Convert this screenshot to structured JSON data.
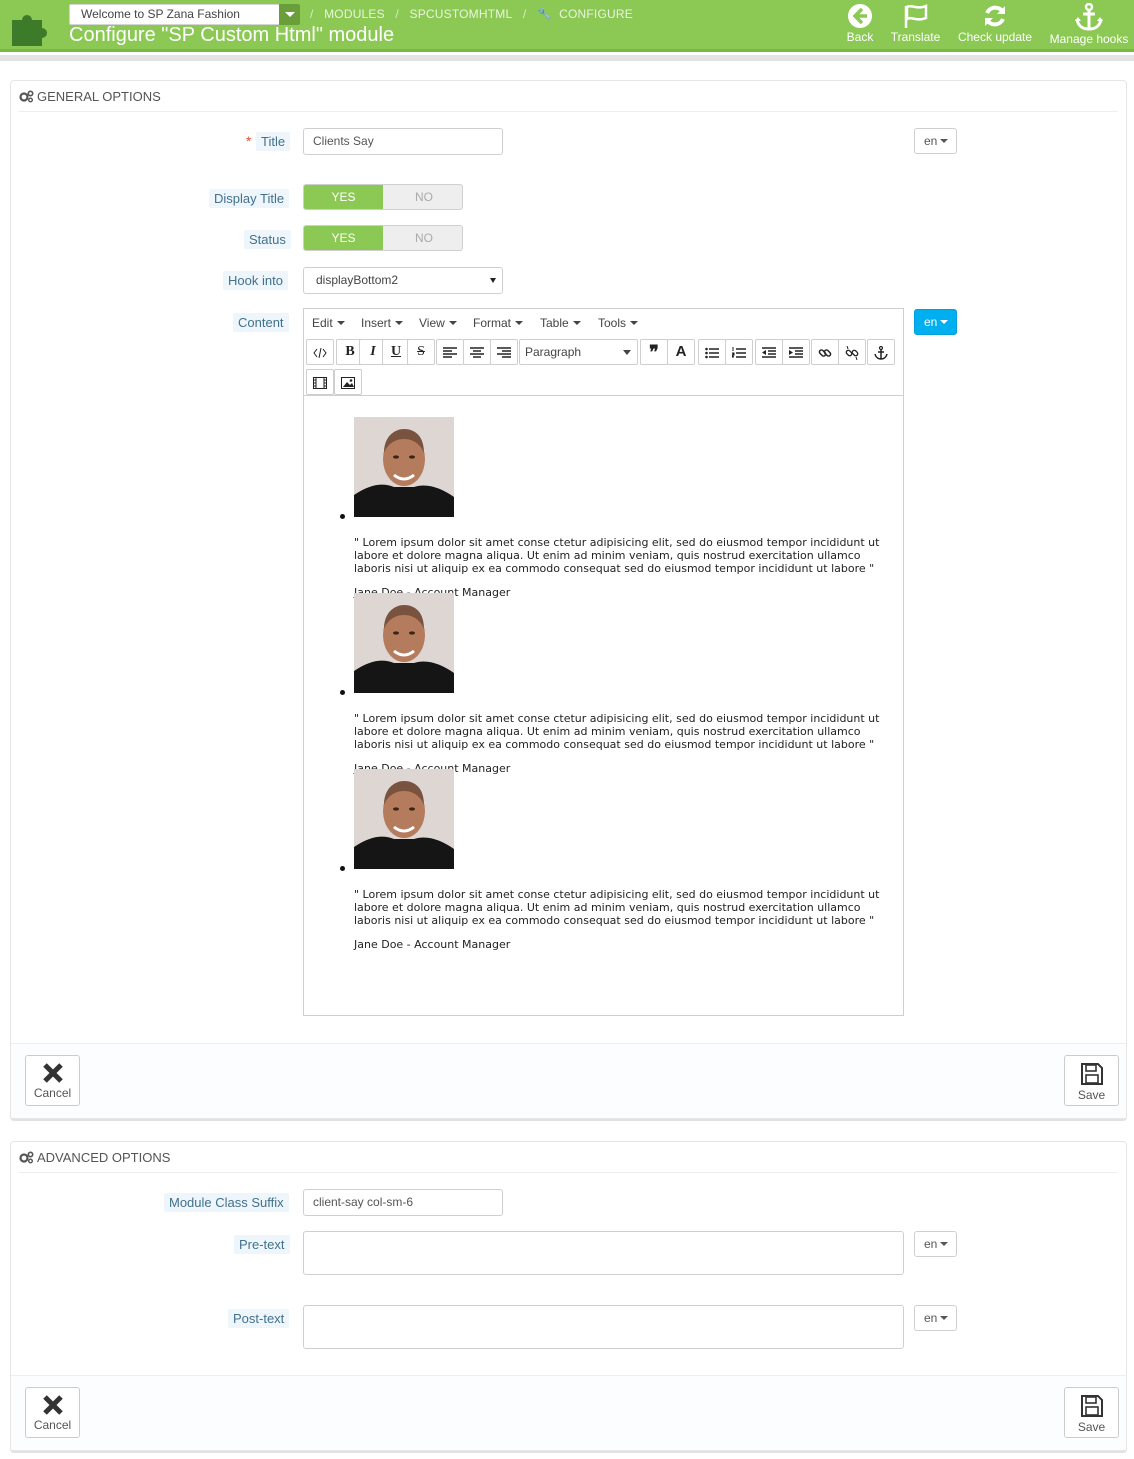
{
  "header": {
    "shop_selector": "Welcome to SP Zana Fashion",
    "breadcrumb": [
      "MODULES",
      "SPCUSTOMHTML",
      "CONFIGURE"
    ],
    "title": "Configure \"SP Custom Html\" module",
    "toolbar": [
      {
        "label": "Back",
        "icon": "back-arrow-icon"
      },
      {
        "label": "Translate",
        "icon": "flag-icon"
      },
      {
        "label": "Check update",
        "icon": "refresh-icon"
      },
      {
        "label": "Manage hooks",
        "icon": "anchor-icon"
      }
    ],
    "accent": "#8bc954"
  },
  "general": {
    "heading": "GENERAL OPTIONS",
    "title_label": "Title",
    "title_value": "Clients Say",
    "lang": "en",
    "display_title_label": "Display Title",
    "status_label": "Status",
    "yes": "YES",
    "no": "NO",
    "hook_label": "Hook into",
    "hook_value": "displayBottom2",
    "content_label": "Content",
    "editor": {
      "menus": [
        "Edit",
        "Insert",
        "View",
        "Format",
        "Table",
        "Tools"
      ],
      "format_select": "Paragraph",
      "toolbar_icons": [
        "code-icon",
        "bold-icon",
        "italic-icon",
        "underline-icon",
        "strikethrough-icon",
        "align-left-icon",
        "align-center-icon",
        "align-right-icon",
        "blockquote-icon",
        "text-color-icon",
        "bullet-list-icon",
        "numbered-list-icon",
        "outdent-icon",
        "indent-icon",
        "link-icon",
        "unlink-icon",
        "anchor-icon",
        "media-icon",
        "image-icon"
      ],
      "testimonials": [
        {
          "quote": "\" Lorem ipsum dolor sit amet conse ctetur adipisicing elit, sed do eiusmod tempor incididunt ut labore et dolore magna aliqua. Ut enim ad minim veniam, quis nostrud exercitation ullamco laboris nisi ut aliquip ex ea commodo consequat sed do eiusmod tempor incididunt ut labore \"",
          "author": "Jane Doe - Account Manager"
        },
        {
          "quote": "\" Lorem ipsum dolor sit amet conse ctetur adipisicing elit, sed do eiusmod tempor incididunt ut labore et dolore magna aliqua. Ut enim ad minim veniam, quis nostrud exercitation ullamco laboris nisi ut aliquip ex ea commodo consequat sed do eiusmod tempor incididunt ut labore \"",
          "author": "Jane Doe - Account Manager"
        },
        {
          "quote": "\" Lorem ipsum dolor sit amet conse ctetur adipisicing elit, sed do eiusmod tempor incididunt ut labore et dolore magna aliqua. Ut enim ad minim veniam, quis nostrud exercitation ullamco laboris nisi ut aliquip ex ea commodo consequat sed do eiusmod tempor incididunt ut labore \"",
          "author": "Jane Doe - Account Manager"
        }
      ]
    },
    "cancel": "Cancel",
    "save": "Save"
  },
  "advanced": {
    "heading": "ADVANCED OPTIONS",
    "suffix_label": "Module Class Suffix",
    "suffix_value": "client-say col-sm-6",
    "pretext_label": "Pre-text",
    "posttext_label": "Post-text",
    "lang": "en",
    "cancel": "Cancel",
    "save": "Save"
  }
}
